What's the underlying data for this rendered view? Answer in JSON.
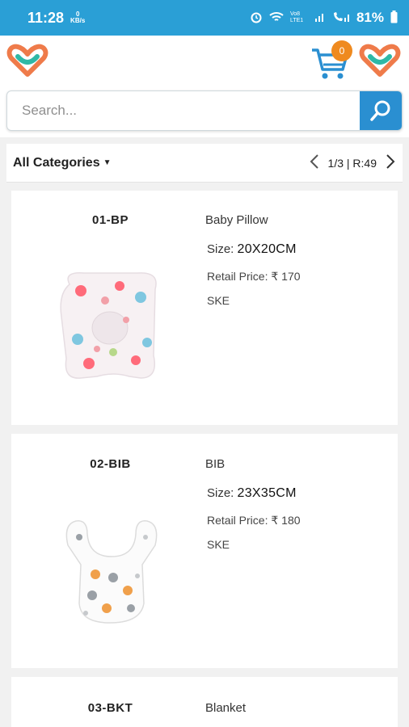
{
  "status_bar": {
    "time": "11:28",
    "net_speed_value": "0",
    "net_speed_unit": "KB/s",
    "network": "Vo8 LTE1",
    "battery": "81%"
  },
  "header": {
    "cart_count": "0"
  },
  "search": {
    "placeholder": "Search..."
  },
  "filter": {
    "category_label": "All Categories",
    "pagination": "1/3 | R:49"
  },
  "products": [
    {
      "code": "01-BP",
      "name": "Baby Pillow",
      "size_label": "Size:",
      "size_value": "20X20CM",
      "price": "Retail Price: ₹ 170",
      "brand": "SKE"
    },
    {
      "code": "02-BIB",
      "name": "BIB",
      "size_label": "Size:",
      "size_value": "23X35CM",
      "price": "Retail Price: ₹ 180",
      "brand": "SKE"
    },
    {
      "code": "03-BKT",
      "name": "Blanket"
    }
  ],
  "colors": {
    "status_bar": "#2a9fd6",
    "accent_blue": "#2a8fd1",
    "badge_orange": "#ef8a1f"
  }
}
